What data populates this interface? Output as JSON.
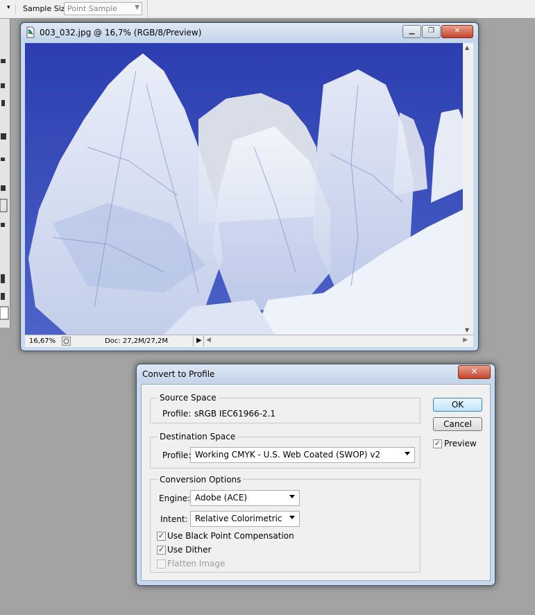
{
  "options_bar": {
    "sample_size_label": "Sample Size:",
    "sample_size_value": "Point Sample"
  },
  "image_window": {
    "title": "003_032.jpg @ 16,7% (RGB/8/Preview)",
    "zoom": "16,67%",
    "doc_info": "Doc: 27,2M/27,2M"
  },
  "dialog": {
    "title": "Convert to Profile",
    "source": {
      "legend": "Source Space",
      "profile_label": "Profile:",
      "profile_value": "sRGB IEC61966-2.1"
    },
    "destination": {
      "legend": "Destination Space",
      "profile_label": "Profile:",
      "profile_value": "Working CMYK - U.S. Web Coated (SWOP) v2"
    },
    "conversion": {
      "legend": "Conversion Options",
      "engine_label": "Engine:",
      "engine_value": "Adobe (ACE)",
      "intent_label": "Intent:",
      "intent_value": "Relative Colorimetric",
      "black_point_label": "Use Black Point Compensation",
      "black_point_checked": true,
      "dither_label": "Use Dither",
      "dither_checked": true,
      "flatten_label": "Flatten Image",
      "flatten_checked": false,
      "flatten_enabled": false
    },
    "ok_label": "OK",
    "cancel_label": "Cancel",
    "preview_label": "Preview",
    "preview_checked": true
  },
  "icons": {
    "check": "✓",
    "close": "✕"
  }
}
